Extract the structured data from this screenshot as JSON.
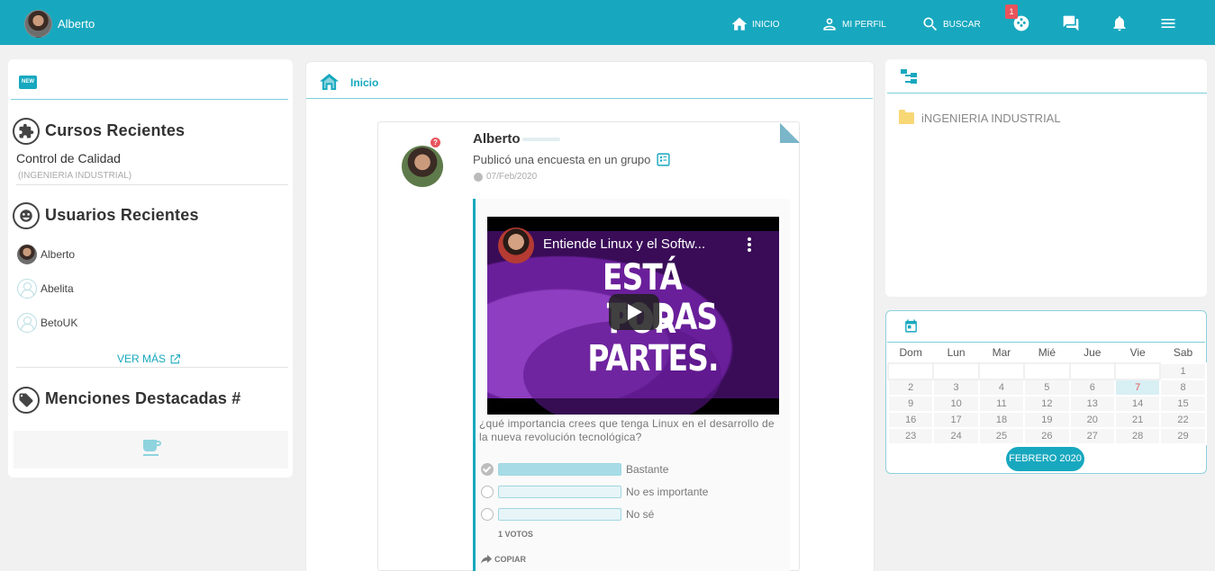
{
  "topbar": {
    "user_name": "Alberto",
    "nav": {
      "home": "INICIO",
      "profile": "MI PERFIL",
      "search": "BUSCAR"
    },
    "notification_count": "1",
    "colors": {
      "bar": "#17a8bf",
      "badge": "#e8545c"
    }
  },
  "left": {
    "recent_courses_title": "Cursos Recientes",
    "course": {
      "name": "Control de Calidad",
      "group": "(INGENIERIA INDUSTRIAL)"
    },
    "recent_users_title": "Usuarios Recientes",
    "users": [
      {
        "name": "Alberto"
      },
      {
        "name": "Abelita"
      },
      {
        "name": "BetoUK"
      }
    ],
    "see_more": "VER MÁS",
    "mentions_title": "Menciones Destacadas #",
    "new_badge": "NEW"
  },
  "center": {
    "header": "Inicio",
    "post": {
      "author": "Alberto",
      "action": "Publicó una encuesta en un grupo",
      "date": "07/Feb/2020",
      "video": {
        "title": "Entiende Linux y el Softw...",
        "caption_lines": [
          "ESTÁ POR",
          "TODAS",
          "PARTES."
        ]
      },
      "question": "¿qué importancia crees que tenga Linux en el desarrollo de la nueva revolución tecnológica?",
      "options": [
        {
          "label": "Bastante",
          "share": 1.0,
          "selected": true
        },
        {
          "label": "No es importante",
          "share": 0.0,
          "selected": false
        },
        {
          "label": "No sé",
          "share": 0.0,
          "selected": false
        }
      ],
      "votes": "1 VOTOS",
      "copy": "COPIAR"
    }
  },
  "right": {
    "groups": [
      {
        "name": "iNGENIERIA INDUSTRIAL"
      }
    ],
    "calendar": {
      "weekdays": [
        "Dom",
        "Lun",
        "Mar",
        "Mié",
        "Jue",
        "Vie",
        "Sab"
      ],
      "weeks": [
        [
          "",
          "",
          "",
          "",
          "",
          "",
          "1"
        ],
        [
          "2",
          "3",
          "4",
          "5",
          "6",
          "7",
          "8"
        ],
        [
          "9",
          "10",
          "11",
          "12",
          "13",
          "14",
          "15"
        ],
        [
          "16",
          "17",
          "18",
          "19",
          "20",
          "21",
          "22"
        ],
        [
          "23",
          "24",
          "25",
          "26",
          "27",
          "28",
          "29"
        ]
      ],
      "today": "7",
      "month": "FEBRERO 2020"
    }
  }
}
